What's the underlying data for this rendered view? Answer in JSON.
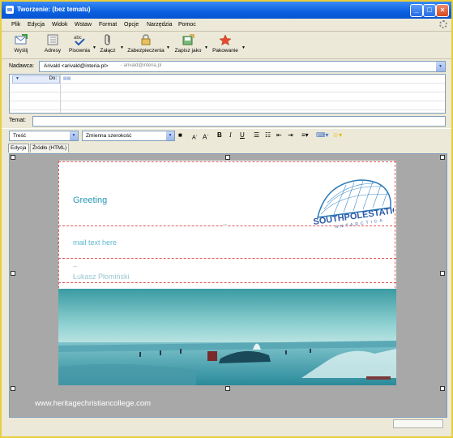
{
  "window": {
    "title": "Tworzenie: (bez tematu)"
  },
  "menu": [
    "Plik",
    "Edycja",
    "Widok",
    "Wstaw",
    "Format",
    "Opcje",
    "Narzędzia",
    "Pomoc"
  ],
  "toolbar": {
    "send": "Wyślij",
    "address": "Adresy",
    "spelling": "Pisownia",
    "attach": "Załącz",
    "security": "Zabezpieczenia",
    "save_as": "Zapisz jako",
    "packing": "Pakowanie",
    "spell_glyph": "abc"
  },
  "sender": {
    "label": "Nadawca:",
    "value": "Arivald <arivald@interia.pl>",
    "secondary": "- arivald@interia.pl"
  },
  "recipients": {
    "type": "Do:"
  },
  "subject": {
    "label": "Temat:",
    "value": ""
  },
  "format": {
    "style": "Treść",
    "font": "Zmienna szerokość"
  },
  "tabs": {
    "edit": "Edycja",
    "source": "Źródło (HTML)"
  },
  "template": {
    "greeting": "Greeting",
    "mail_text": "mail text here",
    "sig_dash": "--",
    "signature": "Łukasz Płomiński",
    "logo_text": "SOUTHPOLESTATION",
    "logo_sub": "ANTARCTICA"
  },
  "watermark": "www.heritagechristiancollege.com",
  "colors": {
    "titlebar": "#0a5fe0",
    "frame": "#e8cf3c",
    "greeting": "#2a98b5",
    "dashed": "#e05a5a"
  }
}
